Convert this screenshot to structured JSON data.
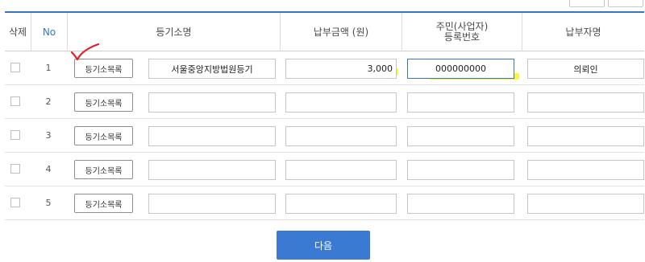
{
  "header": {
    "delete": "삭제",
    "no": "No",
    "registry": "등기소명",
    "amount": "납부금액 (원)",
    "resident_id_line1": "주민(사업자)",
    "resident_id_line2": "등록번호",
    "payer": "납부자명"
  },
  "rows": [
    {
      "no": "1",
      "search_label": "등기소목록",
      "registry": "서울중앙지방법원등기",
      "amount": "3,000",
      "resident_id": "000000000",
      "payer": "의뢰인"
    },
    {
      "no": "2",
      "search_label": "등기소목록",
      "registry": "",
      "amount": "",
      "resident_id": "",
      "payer": ""
    },
    {
      "no": "3",
      "search_label": "등기소목록",
      "registry": "",
      "amount": "",
      "resident_id": "",
      "payer": ""
    },
    {
      "no": "4",
      "search_label": "등기소목록",
      "registry": "",
      "amount": "",
      "resident_id": "",
      "payer": ""
    },
    {
      "no": "5",
      "search_label": "등기소목록",
      "registry": "",
      "amount": "",
      "resident_id": "",
      "payer": ""
    }
  ],
  "next_button": "다음",
  "colors": {
    "accent": "#3a75c4",
    "button": "#3a7ad2",
    "highlight": "#f6f41b",
    "checkmark": "#e0202a"
  }
}
